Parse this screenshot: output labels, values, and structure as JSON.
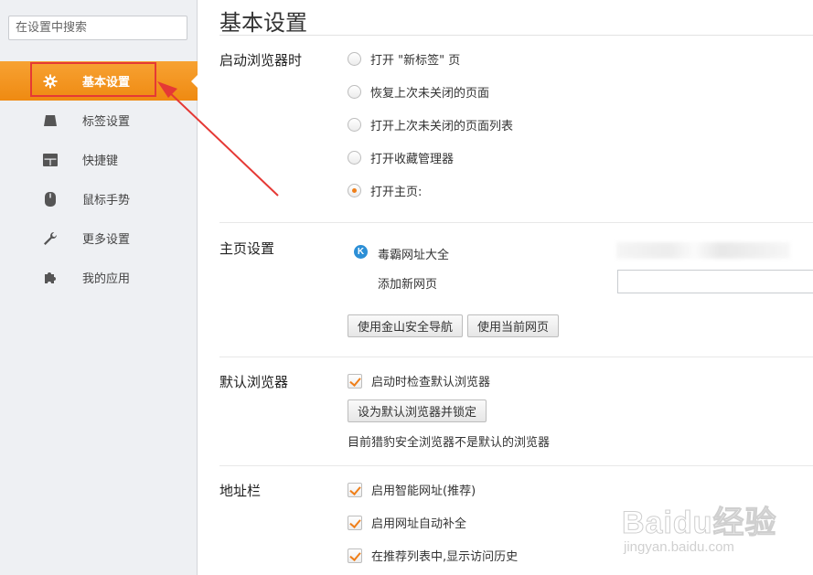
{
  "sidebar": {
    "search_placeholder": "在设置中搜索",
    "items": [
      {
        "label": "基本设置",
        "icon": "gear-icon"
      },
      {
        "label": "标签设置",
        "icon": "tab-icon"
      },
      {
        "label": "快捷键",
        "icon": "keyboard-icon"
      },
      {
        "label": "鼠标手势",
        "icon": "mouse-icon"
      },
      {
        "label": "更多设置",
        "icon": "wrench-icon"
      },
      {
        "label": "我的应用",
        "icon": "puzzle-icon"
      }
    ],
    "active_index": 0
  },
  "main": {
    "title": "基本设置",
    "startup": {
      "label": "启动浏览器时",
      "options": [
        {
          "label": "打开 \"新标签\" 页",
          "checked": false
        },
        {
          "label": "恢复上次未关闭的页面",
          "checked": false
        },
        {
          "label": "打开上次未关闭的页面列表",
          "checked": false
        },
        {
          "label": "打开收藏管理器",
          "checked": false
        },
        {
          "label": "打开主页:",
          "checked": true
        }
      ]
    },
    "homepage": {
      "label": "主页设置",
      "site_name": "毒霸网址大全",
      "site_icon_letter": "K",
      "add_label": "添加新网页",
      "buttons": {
        "use_nav": "使用金山安全导航",
        "use_current": "使用当前网页"
      }
    },
    "default_browser": {
      "label": "默认浏览器",
      "check_label": "启动时检查默认浏览器",
      "checked": true,
      "button": "设为默认浏览器并锁定",
      "note": "目前猎豹安全浏览器不是默认的浏览器"
    },
    "address_bar": {
      "label": "地址栏",
      "options": [
        {
          "label": "启用智能网址(推荐)",
          "checked": true
        },
        {
          "label": "启用网址自动补全",
          "checked": true
        },
        {
          "label": "在推荐列表中,显示访问历史",
          "checked": true
        }
      ]
    }
  },
  "watermark": {
    "main": "Baidu经验",
    "sub": "jingyan.baidu.com"
  },
  "colors": {
    "accent": "#ef8a11",
    "highlight": "#e53935",
    "sidebar_bg": "#eef0f3"
  }
}
